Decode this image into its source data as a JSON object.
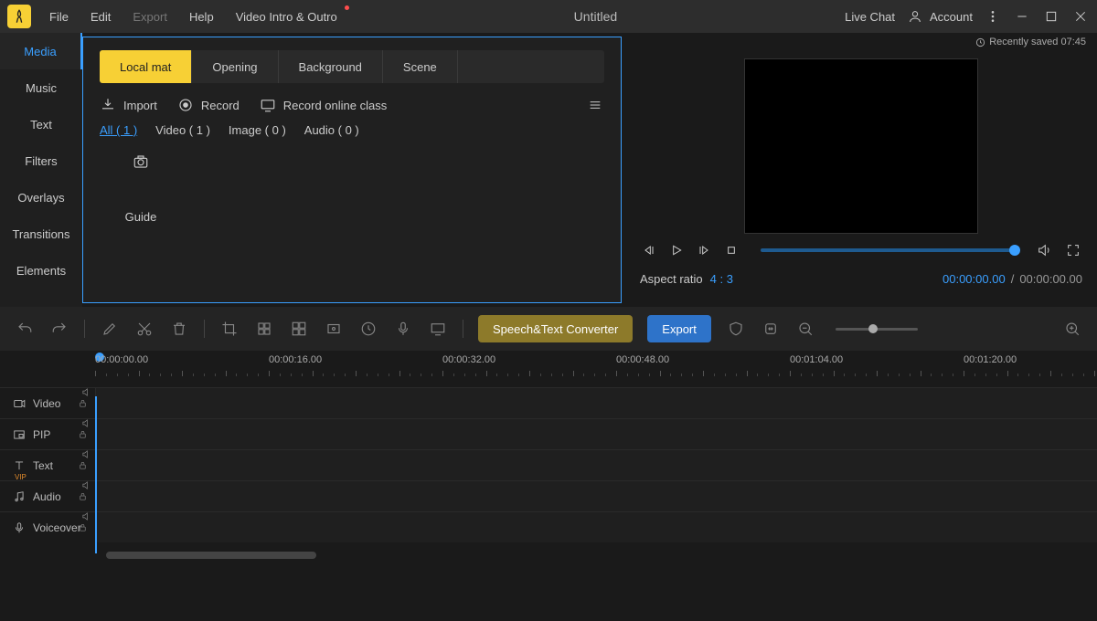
{
  "titlebar": {
    "menu": [
      "File",
      "Edit",
      "Export",
      "Help",
      "Video Intro & Outro"
    ],
    "title": "Untitled",
    "live_chat": "Live Chat",
    "account": "Account"
  },
  "saved": "Recently saved 07:45",
  "sidebar": [
    "Media",
    "Music",
    "Text",
    "Filters",
    "Overlays",
    "Transitions",
    "Elements"
  ],
  "media": {
    "tabs": [
      "Local mat",
      "Opening",
      "Background",
      "Scene"
    ],
    "actions": {
      "import": "Import",
      "record": "Record",
      "record_online": "Record online class"
    },
    "filters": {
      "all": "All ( 1 )",
      "video": "Video ( 1 )",
      "image": "Image ( 0 )",
      "audio": "Audio ( 0 )"
    },
    "item_label": "Guide"
  },
  "preview": {
    "aspect_label": "Aspect ratio",
    "aspect_value": "4 : 3",
    "time_current": "00:00:00.00",
    "time_total": "00:00:00.00"
  },
  "toolbar": {
    "speech": "Speech&Text Converter",
    "export": "Export"
  },
  "ruler": [
    "00:00:00.00",
    "00:00:16.00",
    "00:00:32.00",
    "00:00:48.00",
    "00:01:04.00",
    "00:01:20.00"
  ],
  "tracks": [
    "Video",
    "PIP",
    "Text",
    "Audio",
    "Voiceover"
  ]
}
